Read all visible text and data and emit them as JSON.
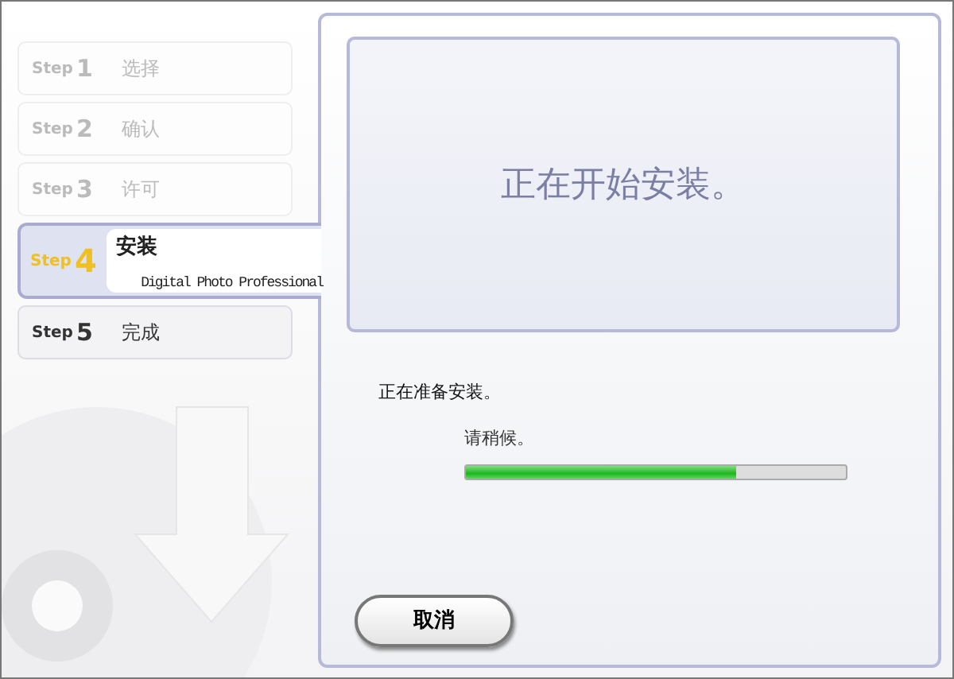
{
  "steps": [
    {
      "label": "Step",
      "number": "1",
      "name": "选择",
      "selected": false,
      "done": true
    },
    {
      "label": "Step",
      "number": "2",
      "name": "确认",
      "selected": false,
      "done": true
    },
    {
      "label": "Step",
      "number": "3",
      "name": "许可",
      "selected": false,
      "done": true
    },
    {
      "label": "Step",
      "number": "4",
      "name": "安装",
      "subtitle": "Digital Photo Professional",
      "selected": true,
      "done": false
    },
    {
      "label": "Step",
      "number": "5",
      "name": "完成",
      "selected": false,
      "done": false
    }
  ],
  "heading": "正在开始安装。",
  "status": "正在准备安装。",
  "progress": {
    "caption": "请稍候。",
    "level": 0.71
  },
  "buttons": [
    "取消"
  ]
}
